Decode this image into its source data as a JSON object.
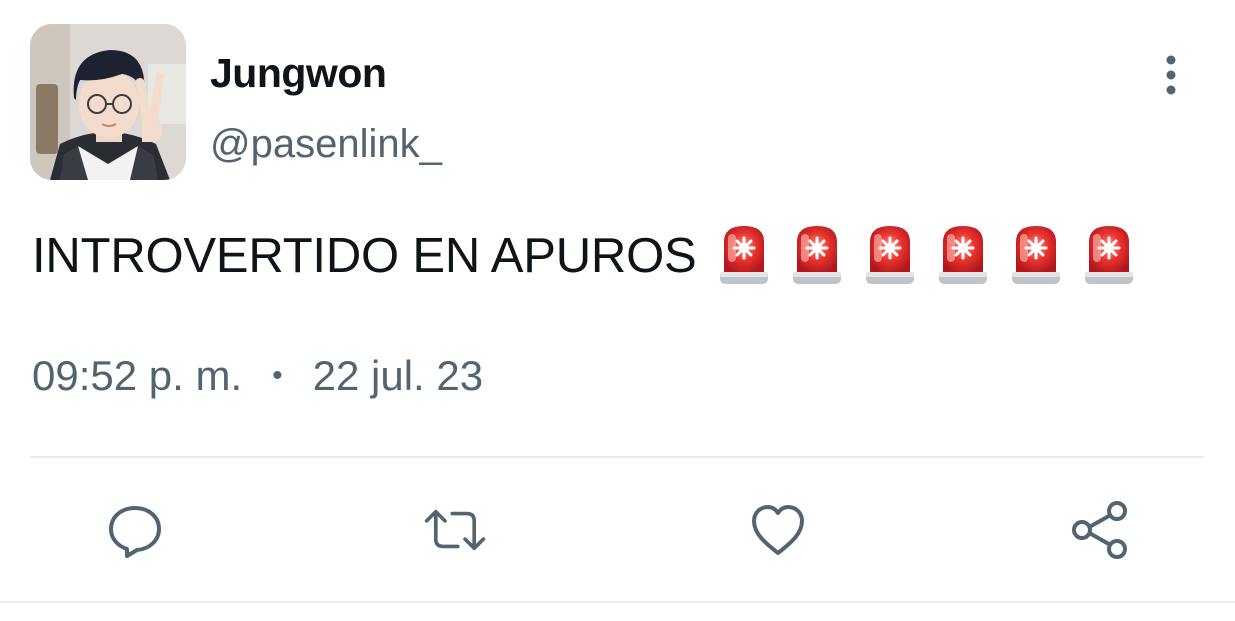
{
  "author": {
    "display_name": "Jungwon",
    "handle": "@pasenlink_",
    "avatar": "profile-photo"
  },
  "tweet": {
    "text": "INTROVERTIDO EN APUROS",
    "emoji": [
      "🚨",
      "🚨",
      "🚨",
      "🚨",
      "🚨",
      "🚨"
    ],
    "time": "09:52 p. m.",
    "separator": "•",
    "date": "22 jul. 23"
  },
  "actions": [
    {
      "name": "reply",
      "icon": "speech-bubble-icon"
    },
    {
      "name": "retweet",
      "icon": "retweet-arrows-icon"
    },
    {
      "name": "like",
      "icon": "heart-icon"
    },
    {
      "name": "share",
      "icon": "share-nodes-icon"
    }
  ],
  "menu": {
    "icon": "vertical-dots-icon"
  },
  "colors": {
    "text_primary": "#0f1419",
    "text_secondary": "#536471",
    "icon": "#536471",
    "siren_red": "#e8332f"
  }
}
